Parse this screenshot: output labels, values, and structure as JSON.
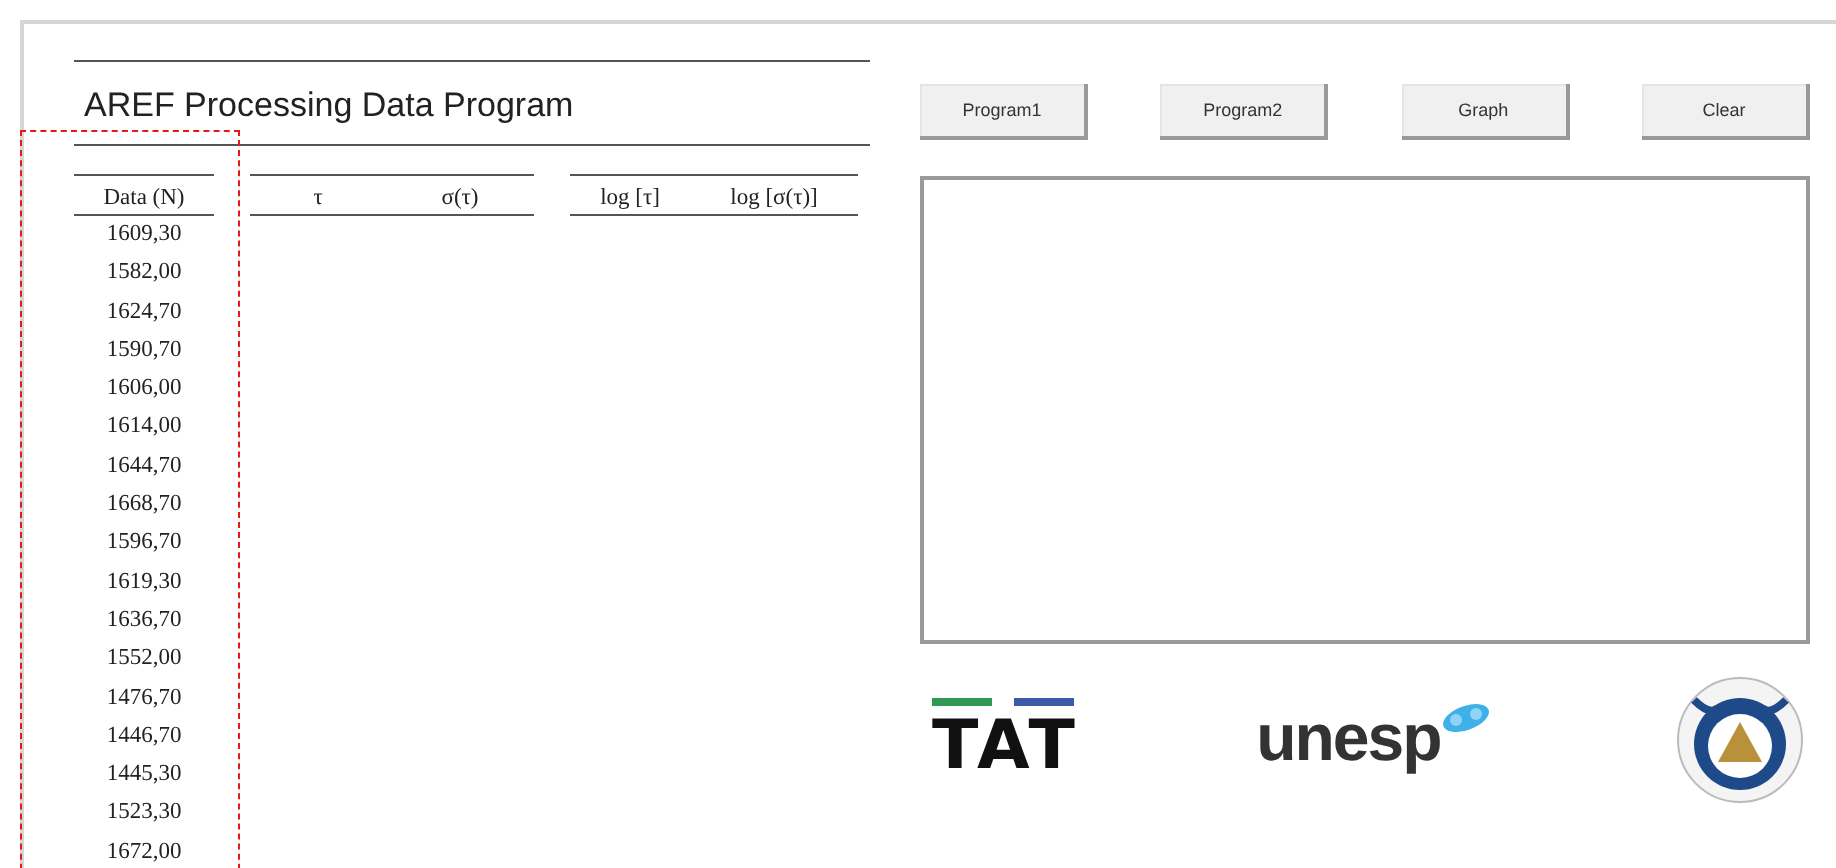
{
  "title": "AREF Processing Data Program",
  "tables": [
    {
      "columns": [
        "Data  (N)"
      ]
    },
    {
      "columns": [
        "τ",
        "σ(τ)"
      ]
    },
    {
      "columns": [
        "log [τ]",
        "log [σ(τ)]"
      ]
    }
  ],
  "data_values": [
    "1609,30",
    "1582,00",
    "1624,70",
    "1590,70",
    "1606,00",
    "1614,00",
    "1644,70",
    "1668,70",
    "1596,70",
    "1619,30",
    "1636,70",
    "1552,00",
    "1476,70",
    "1446,70",
    "1445,30",
    "1523,30",
    "1672,00"
  ],
  "buttons": [
    "Program1",
    "Program2",
    "Graph",
    "Clear"
  ],
  "logos": [
    {
      "kind": "tat",
      "text": "TAT"
    },
    {
      "kind": "unesp",
      "text": "unesp"
    },
    {
      "kind": "emblem"
    }
  ]
}
